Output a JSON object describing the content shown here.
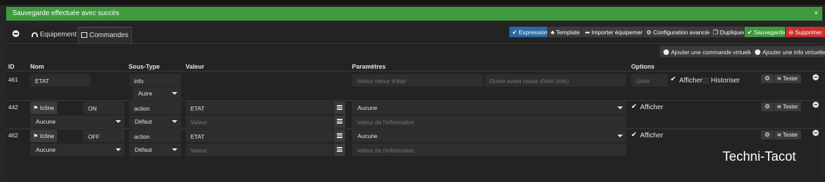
{
  "alert": {
    "text": "Sauvegarde effectuée avec succès",
    "close": "×"
  },
  "tabs": {
    "back": "",
    "equipment": "Equipement",
    "commands": "Commandes"
  },
  "header_buttons": {
    "expression": "Expression",
    "template": "Template",
    "import": "Importer équipement",
    "advanced": "Configuration avancée",
    "duplicate": "Dupliquer",
    "save": "Sauvegarder",
    "delete": "Supprimer"
  },
  "virtual_buttons": {
    "add_command": "Ajouter une commande virtuelle",
    "add_info": "Ajouter une info virtuelle"
  },
  "columns": {
    "id": "ID",
    "name": "Nom",
    "subtype": "Sous-Type",
    "value": "Valeur",
    "params": "Paramètres",
    "options": "Options"
  },
  "rows": [
    {
      "id": "461",
      "name": "ETAT",
      "type": "info",
      "subtype": "Autre",
      "param1_placeholder": "Valeur retour d'état",
      "param2_placeholder": "Durée avant retour d'état (min)",
      "unit_placeholder": "Unité",
      "afficher": "Afficher",
      "historiser": "Historiser",
      "tester": "Tester"
    },
    {
      "id": "442",
      "icon_label": "Icône",
      "name": "ON",
      "type": "action",
      "subtype": "Défaut",
      "value": "ETAT",
      "value_placeholder": "Valeur",
      "linked_select": "Aucune",
      "param_select": "Aucune",
      "param_info_placeholder": "Valeur de l'information",
      "afficher": "Afficher",
      "tester": "Tester"
    },
    {
      "id": "462",
      "icon_label": "Icône",
      "name": "OFF",
      "type": "action",
      "subtype": "Défaut",
      "value": "ETAT",
      "value_placeholder": "Valeur",
      "linked_select": "Aucune",
      "param_select": "Aucune",
      "param_info_placeholder": "Valeur de l'information",
      "afficher": "Afficher",
      "tester": "Tester"
    }
  ],
  "watermark": "Techni-Tacot",
  "colors": {
    "success": "#3e9a3e",
    "primary": "#2b6aa5",
    "danger": "#c9302c",
    "background": "#262626"
  }
}
